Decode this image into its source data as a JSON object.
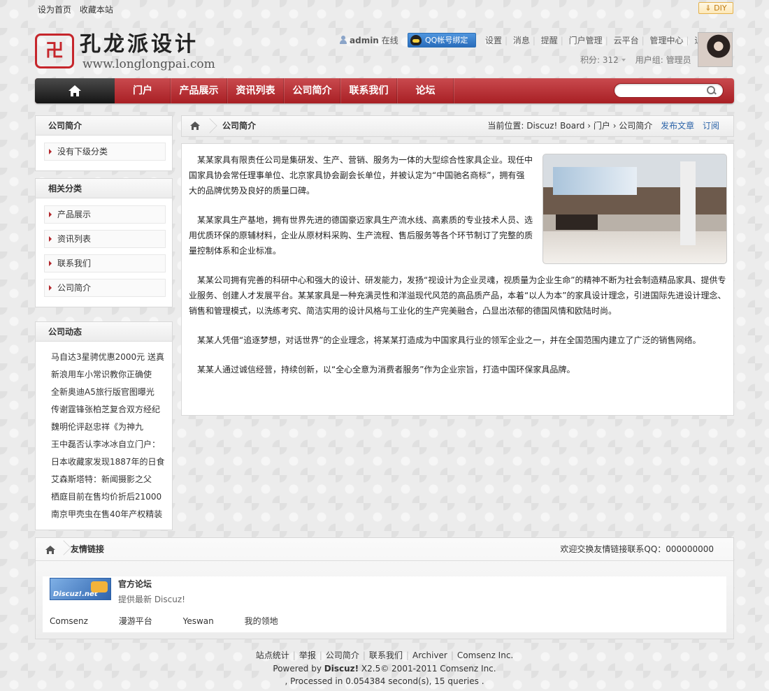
{
  "topbar": {
    "set_home": "设为首页",
    "bookmark": "收藏本站",
    "diy": "DIY"
  },
  "logo": {
    "seal": "卍",
    "title": "孔龙派设计",
    "url": "www.longlongpai.com"
  },
  "user": {
    "name": "admin",
    "status": "在线",
    "qq_bind": "QQ帐号绑定",
    "menu": [
      "设置",
      "消息",
      "提醒",
      "门户管理",
      "云平台",
      "管理中心",
      "退出"
    ],
    "credits": "积分: 312",
    "group": "用户组: 管理员"
  },
  "nav": {
    "items": [
      "门户",
      "产品展示",
      "资讯列表",
      "公司简介",
      "联系我们",
      "论坛"
    ],
    "search_placeholder": ""
  },
  "sidebar": {
    "company_intro": {
      "title": "公司简介",
      "items": [
        "没有下级分类"
      ]
    },
    "related": {
      "title": "相关分类",
      "items": [
        "产品展示",
        "资讯列表",
        "联系我们",
        "公司简介"
      ]
    },
    "news": {
      "title": "公司动态",
      "items": [
        "马自达3星骋优惠2000元 送真",
        "新浪用车小常识教你正确使",
        "全新奥迪A5旅行版官图曝光",
        "传谢霆锋张柏芝复合双方经纪",
        "魏明伦评赵忠祥《为神九",
        "王中磊否认李冰冰自立门户：",
        "日本收藏家发现1887年的日食",
        "艾森斯塔特：新闻摄影之父",
        "栖庭目前在售均价折后21000",
        "南京甲壳虫在售40年产权精装"
      ]
    }
  },
  "crumb": {
    "title": "公司简介",
    "location": "当前位置: Discuz! Board › 门户 › 公司简介",
    "publish": "发布文章",
    "subscribe": "订阅"
  },
  "article": {
    "paragraphs": [
      "某某家具有限责任公司是集研发、生产、营销、服务为一体的大型综合性家具企业。现任中国家具协会常任理事单位、北京家具协会副会长单位，并被认定为“中国驰名商标”，拥有强大的品牌优势及良好的质量口碑。",
      "某某家具生产基地，拥有世界先进的德国豪迈家具生产流水线、高素质的专业技术人员、选用优质环保的原辅材料，企业从原材料采购、生产流程、售后服务等各个环节制订了完整的质量控制体系和企业标准。",
      "某某公司拥有完善的科研中心和强大的设计、研发能力，发扬“视设计为企业灵魂，视质量为企业生命”的精神不断为社会制造精品家具、提供专业服务、创建人才发展平台。某某家具是一种充满灵性和洋溢现代风范的高品质产品，本着“以人为本”的家具设计理念，引进国际先进设计理念、销售和管理模式，以洗练考究、简洁实用的设计风格与工业化的生产完美融合，凸显出浓郁的德国风情和欧陆时尚。",
      "某某人凭借“追逐梦想，对话世界”的企业理念，将某某打造成为中国家具行业的领军企业之一，并在全国范围内建立了广泛的销售网络。",
      "某某人通过诚信经营，持续创新，以“全心全意为消费者服务”作为企业宗旨，打造中国环保家具品牌。"
    ]
  },
  "friend_links": {
    "title": "友情链接",
    "contact": "欢迎交换友情链接联系QQ：000000000",
    "logo_text": "Discuz!.net",
    "partner_name": "官方论坛",
    "partner_desc": "提供最新 Discuz!",
    "text_links": [
      "Comsenz",
      "漫游平台",
      "Yeswan",
      "我的领地"
    ]
  },
  "footer": {
    "links": [
      "站点统计",
      "举报",
      "公司简介",
      "联系我们",
      "Archiver",
      "Comsenz Inc."
    ],
    "powered_prefix": "Powered by ",
    "powered_brand": "Discuz!",
    "powered_suffix": " X2.5© 2001-2011 Comsenz Inc.",
    "processed": ", Processed in 0.054384 second(s), 15 queries ."
  }
}
